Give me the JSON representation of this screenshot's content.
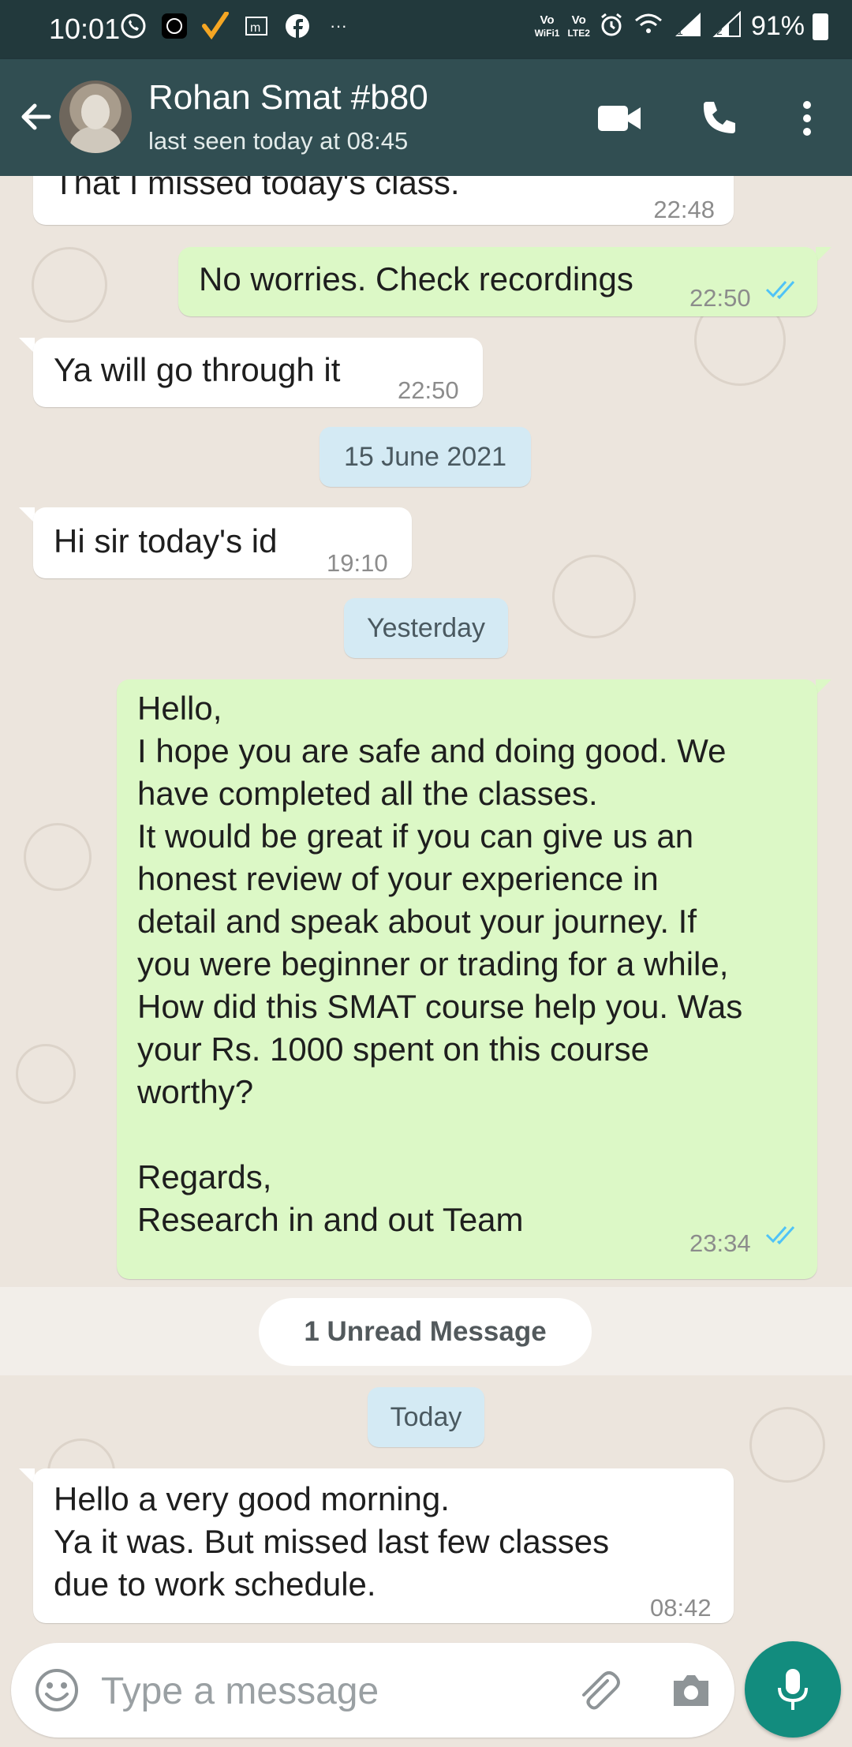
{
  "status_bar": {
    "time": "10:01",
    "battery": "91%",
    "volte1": "Vo WiFi1",
    "volte2": "Vo LTE2",
    "sim1": "1",
    "sim2": "2",
    "notification_icons": [
      "whatsapp-icon",
      "zee5-icon",
      "check-app-icon",
      "m-icon",
      "facebook-icon",
      "more-notifications-icon"
    ]
  },
  "header": {
    "contact_name": "Rohan Smat #b80",
    "last_seen": "last seen today at 08:45"
  },
  "messages": [
    {
      "dir": "in",
      "text": "That I missed today's class.",
      "time": "22:48"
    },
    {
      "dir": "out",
      "text": "No worries. Check recordings",
      "time": "22:50",
      "status": "read"
    },
    {
      "dir": "in",
      "text": "Ya will go through it",
      "time": "22:50"
    },
    {
      "dir": "date",
      "text": "15 June 2021"
    },
    {
      "dir": "in",
      "text": "Hi sir today's id",
      "time": "19:10"
    },
    {
      "dir": "date",
      "text": "Yesterday"
    },
    {
      "dir": "out",
      "text": "Hello,\nI hope you are safe and doing good. We\nhave completed all the classes.\nIt would be great if you can give us an\nhonest review of your experience in\ndetail and speak about your journey. If\nyou were beginner or trading for a while,\nHow did this SMAT course help you. Was\nyour Rs. 1000 spent on this course\nworthy?\n\nRegards,\nResearch in and out Team",
      "time": "23:34",
      "status": "read"
    },
    {
      "dir": "unread",
      "text": "1 Unread Message"
    },
    {
      "dir": "date",
      "text": "Today"
    },
    {
      "dir": "in",
      "text": "Hello a very good morning.\nYa it was. But missed last few classes\ndue to work schedule.",
      "time": "08:42"
    }
  ],
  "input": {
    "placeholder": "Type a message"
  },
  "colors": {
    "header_bg": "#314e52",
    "chat_bg": "#ece5dd",
    "outgoing_bubble": "#dcf8c6",
    "incoming_bubble": "#ffffff",
    "read_ticks": "#4fc3f7",
    "mic_button": "#128c7e"
  }
}
